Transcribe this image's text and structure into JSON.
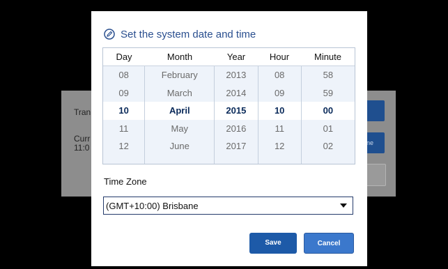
{
  "background": {
    "label1": "Tran",
    "label2": "Curr",
    "label3": "11:0",
    "button_partial": "ne"
  },
  "dialog": {
    "title": "Set the system date and time",
    "icon": "pencil-circle-icon",
    "columns": [
      {
        "header": "Day",
        "values": [
          "08",
          "09",
          "10",
          "11",
          "12"
        ]
      },
      {
        "header": "Month",
        "values": [
          "February",
          "March",
          "April",
          "May",
          "June"
        ]
      },
      {
        "header": "Year",
        "values": [
          "2013",
          "2014",
          "2015",
          "2016",
          "2017"
        ]
      },
      {
        "header": "Hour",
        "values": [
          "08",
          "09",
          "10",
          "11",
          "12"
        ]
      },
      {
        "header": "Minute",
        "values": [
          "58",
          "59",
          "00",
          "01",
          "02"
        ]
      }
    ],
    "timezone_label": "Time Zone",
    "timezone_value": "(GMT+10:00) Brisbane",
    "save_label": "Save",
    "cancel_label": "Cancel"
  },
  "colors": {
    "accent": "#1d5aa8",
    "title": "#2a4f8f",
    "picker_bg": "#eef3fa"
  }
}
